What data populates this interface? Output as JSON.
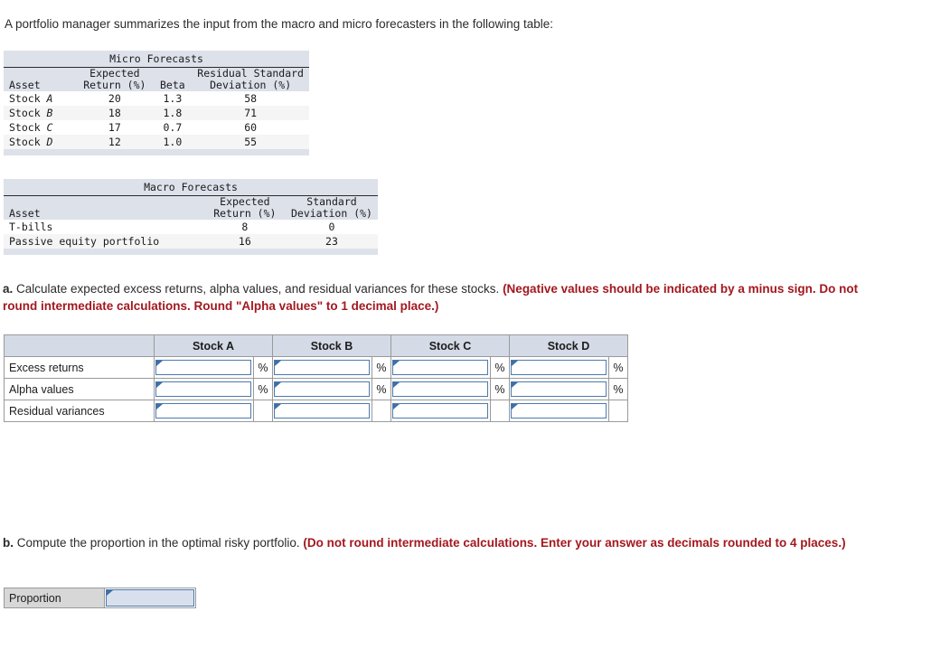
{
  "intro": "A portfolio manager summarizes the input from the macro and micro forecasters in the following table:",
  "micro_forecasts": {
    "title": "Micro Forecasts",
    "headers_top": [
      "",
      "Expected",
      "",
      "Residual Standard"
    ],
    "headers_bottom": [
      "Asset",
      "Return (%)",
      "Beta",
      "Deviation (%)"
    ],
    "rows": [
      {
        "asset_prefix": "Stock ",
        "asset_letter": "A",
        "expected_return": "20",
        "beta": "1.3",
        "residual_sd": "58"
      },
      {
        "asset_prefix": "Stock ",
        "asset_letter": "B",
        "expected_return": "18",
        "beta": "1.8",
        "residual_sd": "71"
      },
      {
        "asset_prefix": "Stock ",
        "asset_letter": "C",
        "expected_return": "17",
        "beta": "0.7",
        "residual_sd": "60"
      },
      {
        "asset_prefix": "Stock ",
        "asset_letter": "D",
        "expected_return": "12",
        "beta": "1.0",
        "residual_sd": "55"
      }
    ]
  },
  "macro_forecasts": {
    "title": "Macro Forecasts",
    "headers_top": [
      "",
      "Expected",
      "Standard"
    ],
    "headers_bottom": [
      "Asset",
      "Return (%)",
      "Deviation (%)"
    ],
    "rows": [
      {
        "asset": "T-bills",
        "expected_return": "8",
        "standard_deviation": "0"
      },
      {
        "asset": "Passive equity portfolio",
        "expected_return": "16",
        "standard_deviation": "23"
      }
    ]
  },
  "question_a": {
    "label": "a.",
    "text": " Calculate expected excess returns, alpha values, and residual variances for these stocks. ",
    "emphasis": "(Negative values should be indicated by a minus sign. Do not round intermediate calculations. Round \"Alpha values\" to 1 decimal place.)"
  },
  "answer_table": {
    "corner_header": "",
    "column_headers": [
      "Stock A",
      "Stock B",
      "Stock C",
      "Stock D"
    ],
    "rows": [
      {
        "label": "Excess returns",
        "values": [
          "",
          "",
          "",
          ""
        ],
        "suffix": "%"
      },
      {
        "label": "Alpha values",
        "values": [
          "",
          "",
          "",
          ""
        ],
        "suffix": "%"
      },
      {
        "label": "Residual variances",
        "values": [
          "",
          "",
          "",
          ""
        ],
        "suffix": ""
      }
    ]
  },
  "question_b": {
    "label": "b.",
    "text": " Compute the proportion in the optimal risky portfolio. ",
    "emphasis": "(Do not round intermediate calculations. Enter your answer as decimals rounded to 4 places.)"
  },
  "proportion_row": {
    "label": "Proportion",
    "value": ""
  },
  "colors": {
    "table_header_fill": "#d4dae6",
    "mono_header_fill": "#dde1ea",
    "input_border": "#4a7ab0",
    "input_fill_active": "#d8e0ee",
    "emphasis_red": "#a3181f",
    "row_stripe": "#f5f5f5"
  }
}
